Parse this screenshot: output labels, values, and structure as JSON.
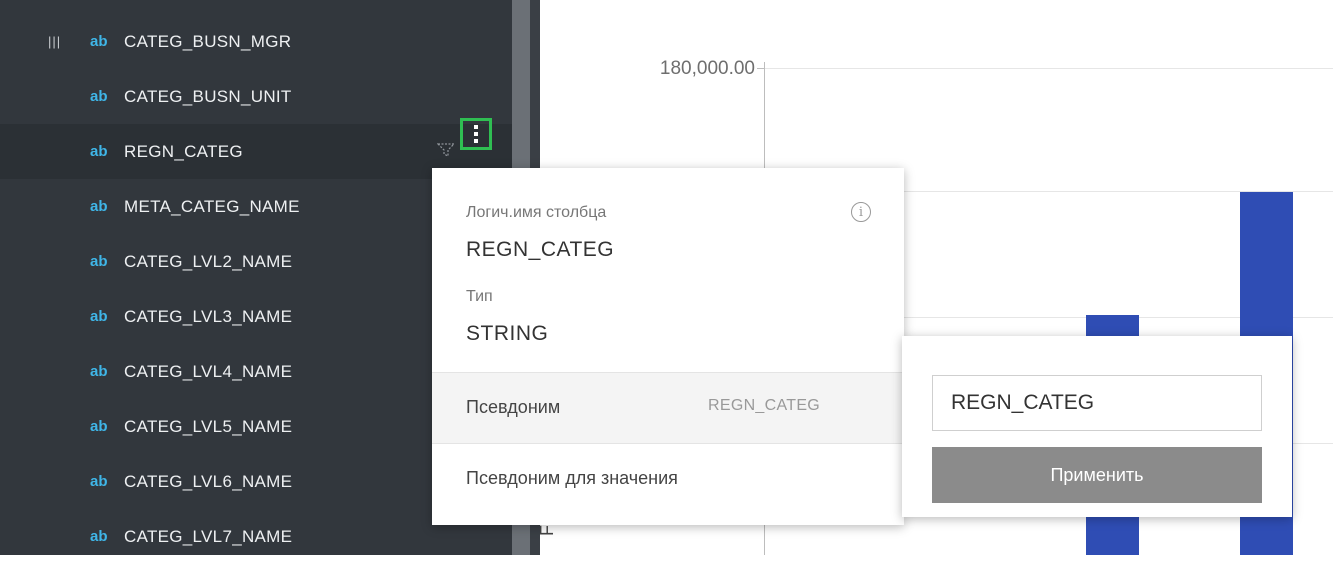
{
  "sidebar": {
    "drag_handle": "|||",
    "type_badge": "ab",
    "fields": [
      {
        "label": "CATEG_BUSN_MGR"
      },
      {
        "label": "CATEG_BUSN_UNIT"
      },
      {
        "label": "REGN_CATEG"
      },
      {
        "label": "META_CATEG_NAME"
      },
      {
        "label": "CATEG_LVL2_NAME"
      },
      {
        "label": "CATEG_LVL3_NAME"
      },
      {
        "label": "CATEG_LVL4_NAME"
      },
      {
        "label": "CATEG_LVL5_NAME"
      },
      {
        "label": "CATEG_LVL6_NAME"
      },
      {
        "label": "CATEG_LVL7_NAME"
      }
    ],
    "selected_index": 2
  },
  "chart": {
    "y_tick_label": "180,000.00",
    "y_axis_fragment": "F",
    "bar_color": "#2f4db4"
  },
  "popover": {
    "logical_name_label": "Логич.имя столбца",
    "logical_name_value": "REGN_CATEG",
    "type_label": "Тип",
    "type_value": "STRING",
    "alias_label": "Псевдоним",
    "alias_value": "REGN_CATEG",
    "value_alias_label": "Псевдоним для значения",
    "info_icon": "info-icon"
  },
  "alias_editor": {
    "input_value": "REGN_CATEG",
    "apply_label": "Применить"
  },
  "colors": {
    "sidebar_bg": "#32373d",
    "type_badge": "#3fb6e8",
    "highlight_border": "#2fbe52",
    "apply_button": "#8b8b8b"
  }
}
